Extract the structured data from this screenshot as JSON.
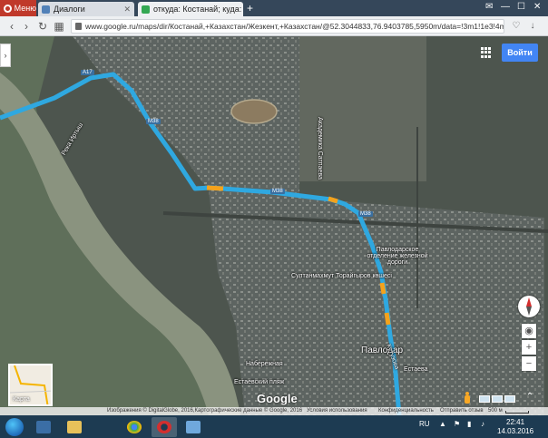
{
  "browser": {
    "menu_label": "Меню",
    "tabs": [
      {
        "label": "Диалоги",
        "active": false,
        "favicon_color": "#5181b8"
      },
      {
        "label": "откуда: Костанай; куда: Ж",
        "active": true,
        "favicon_color": "#34a853"
      }
    ],
    "new_tab_label": "+",
    "window_controls": [
      "✉",
      "—",
      "☐",
      "✕"
    ],
    "address": "www.google.ru/maps/dir/Костанай,+Казахстан/Жезкент,+Казахстан/@52.3044833,76.9403785,5950m/data=!3m1!1e3!4m19!4m18!"
  },
  "map": {
    "signin_label": "Войти",
    "labels": {
      "city": "Павлодар",
      "river": "Река Иртыш",
      "street_1": "Султанмахмут Торайгыров көшесі",
      "station": "Павлодарское отделение железной дороги",
      "embankment": "Набережная",
      "beach": "Естаевский пляж",
      "street_2": "Академика Сатпаева",
      "street_3": "Естаева",
      "street_4": "Кутузова"
    },
    "road_shields": [
      "А17",
      "M38",
      "M38",
      "M38"
    ],
    "layer_toggle_label": "Карта",
    "logo": "Google",
    "attribution": {
      "imagery": "Изображения © DigitalGlobe, 2016,Картографические данные © Google, 2016",
      "terms": "Условия использования",
      "privacy": "Конфиденциальность",
      "feedback": "Отправить отзыв",
      "scale": "500 м"
    },
    "colors": {
      "route": "#2fa8e0",
      "route_traffic": "#f4a21c",
      "signin_bg": "#4285f4"
    }
  },
  "taskbar": {
    "language": "RU",
    "time": "22:41",
    "date": "14.03.2016",
    "apps": [
      "windows-explorer",
      "file-manager",
      "chrome",
      "opera",
      "photo-viewer"
    ]
  }
}
